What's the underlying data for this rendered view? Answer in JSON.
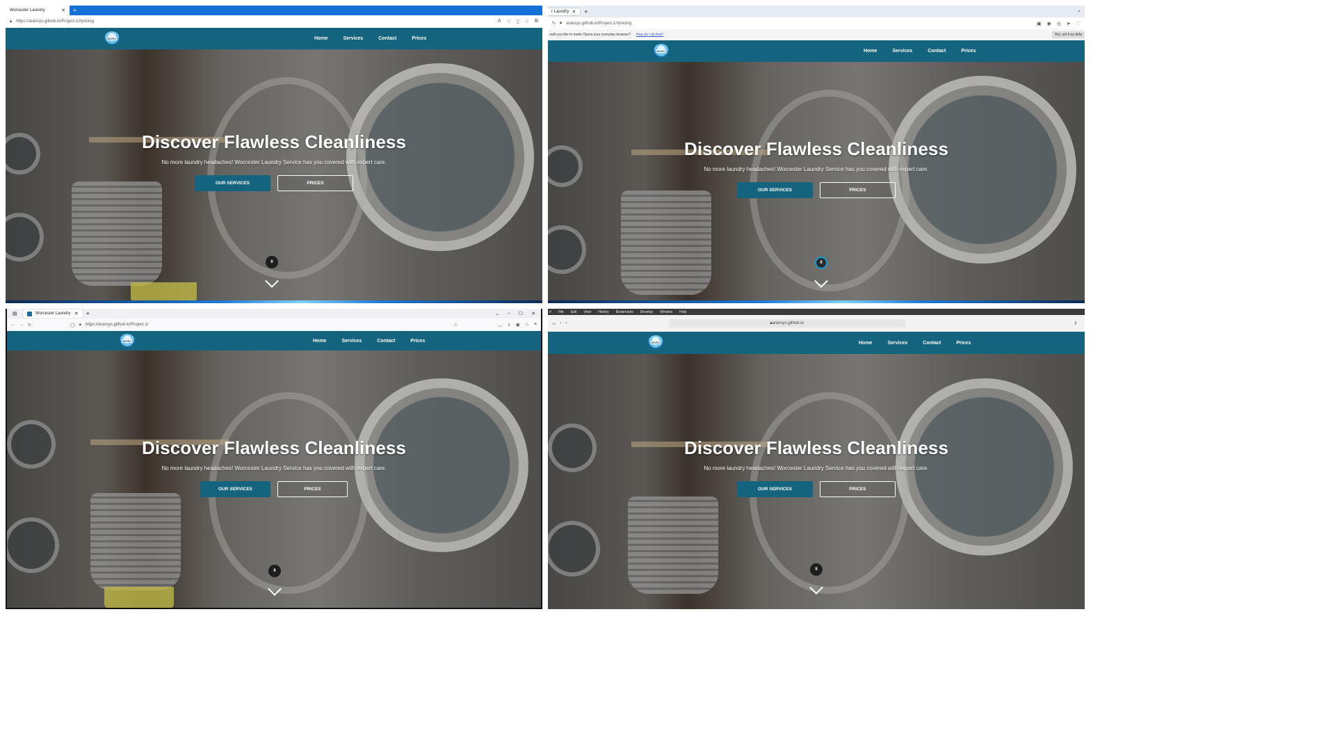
{
  "site": {
    "logo_text": "WORC",
    "nav": [
      "Home",
      "Services",
      "Contact",
      "Prices"
    ],
    "hero_title": "Discover Flawless Cleanliness",
    "hero_subtitle": "No more laundry headaches! Worcester Laundry Service has you covered with expert care.",
    "btn_services": "OUR SERVICES",
    "btn_prices": "PRICES",
    "pause_symbol": "II",
    "brand_color": "#14647f"
  },
  "panes": [
    {
      "browser": "Edge",
      "tab_title": "Worcester Laundry",
      "tab_close": "✕",
      "new_tab": "+",
      "url": "https://aransys.github.io/Project-1/#pricing",
      "toolbar_icons": [
        "read-aloud-icon",
        "star-icon",
        "split-icon",
        "favorites-icon",
        "collections-icon"
      ]
    },
    {
      "browser": "Opera",
      "tab_title": "r Laundry",
      "tab_close": "✕",
      "new_tab": "+",
      "url": "aransys.github.io/Project-1/#pricing",
      "info_text": "ould you like to make Opera your everyday browser?",
      "info_link": "How do I do that?",
      "info_button": "Yes, set it as defa"
    },
    {
      "browser": "Firefox",
      "tab_title": "Worcester Laundry",
      "tab_close": "✕",
      "new_tab": "+",
      "url": "https://aransys.github.io/Project-1/",
      "window_controls": [
        "⌄",
        "–",
        "☐",
        "✕"
      ]
    },
    {
      "browser": "Safari",
      "menu": [
        "rl",
        "File",
        "Edit",
        "View",
        "History",
        "Bookmarks",
        "Develop",
        "Window",
        "Help"
      ],
      "url": "aransys.github.io"
    }
  ]
}
